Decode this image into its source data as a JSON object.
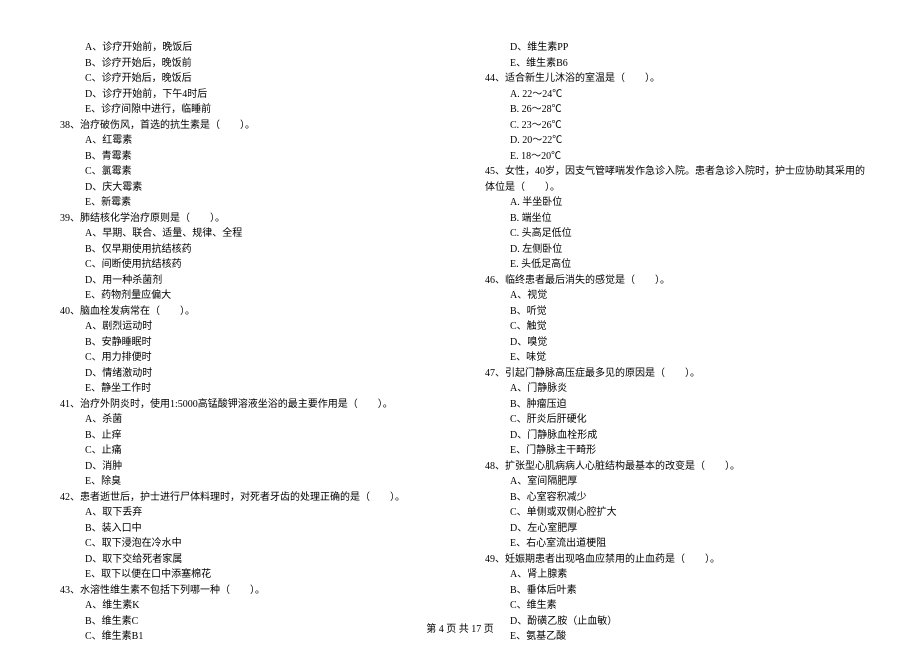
{
  "left": {
    "q37_opts": [
      "A、诊疗开始前，晚饭后",
      "B、诊疗开始后，晚饭前",
      "C、诊疗开始后，晚饭后",
      "D、诊疗开始前，下午4时后",
      "E、诊疗间隙中进行，临睡前"
    ],
    "q38": "38、治疗破伤风，首选的抗生素是（　　）。",
    "q38_opts": [
      "A、红霉素",
      "B、青霉素",
      "C、氯霉素",
      "D、庆大霉素",
      "E、新霉素"
    ],
    "q39": "39、肺结核化学治疗原则是（　　）。",
    "q39_opts": [
      "A、早期、联合、适量、规律、全程",
      "B、仅早期使用抗结核药",
      "C、间断使用抗结核药",
      "D、用一种杀菌剂",
      "E、药物剂量应偏大"
    ],
    "q40": "40、脑血栓发病常在（　　）。",
    "q40_opts": [
      "A、剧烈运动时",
      "B、安静睡眠时",
      "C、用力排便时",
      "D、情绪激动时",
      "E、静坐工作时"
    ],
    "q41": "41、治疗外阴炎时，使用1:5000高锰酸钾溶液坐浴的最主要作用是（　　）。",
    "q41_opts": [
      "A、杀菌",
      "B、止痒",
      "C、止痛",
      "D、消肿",
      "E、除臭"
    ],
    "q42": "42、患者逝世后，护士进行尸体料理时，对死者牙齿的处理正确的是（　　）。",
    "q42_opts": [
      "A、取下丢弃",
      "B、装入口中",
      "C、取下浸泡在冷水中",
      "D、取下交给死者家属",
      "E、取下以便在口中添塞棉花"
    ],
    "q43": "43、水溶性维生素不包括下列哪一种（　　）。",
    "q43_opts": [
      "A、维生素K",
      "B、维生素C",
      "C、维生素B1"
    ]
  },
  "right": {
    "q43_opts_cont": [
      "D、维生素PP",
      "E、维生素B6"
    ],
    "q44": "44、适合新生儿沐浴的室温是（　　）。",
    "q44_opts": [
      "A. 22～24℃",
      "B. 26～28℃",
      "C. 23～26℃",
      "D. 20～22℃",
      "E. 18～20℃"
    ],
    "q45": "45、女性，40岁，因支气管哮喘发作急诊入院。患者急诊入院时，护士应协助其采用的体位是（　　）。",
    "q45_opts": [
      "A. 半坐卧位",
      "B. 端坐位",
      "C. 头高足低位",
      "D. 左侧卧位",
      "E. 头低足高位"
    ],
    "q46": "46、临终患者最后消失的感觉是（　　）。",
    "q46_opts": [
      "A、视觉",
      "B、听觉",
      "C、触觉",
      "D、嗅觉",
      "E、味觉"
    ],
    "q47": "47、引起门静脉高压症最多见的原因是（　　）。",
    "q47_opts": [
      "A、门静脉炎",
      "B、肿瘤压迫",
      "C、肝炎后肝硬化",
      "D、门静脉血栓形成",
      "E、门静脉主干畸形"
    ],
    "q48": "48、扩张型心肌病病人心脏结构最基本的改变是（　　）。",
    "q48_opts": [
      "A、室间隔肥厚",
      "B、心室容积减少",
      "C、单侧或双侧心腔扩大",
      "D、左心室肥厚",
      "E、右心室流出道梗阻"
    ],
    "q49": "49、妊娠期患者出现咯血应禁用的止血药是（　　）。",
    "q49_opts": [
      "A、肾上腺素",
      "B、垂体后叶素",
      "C、维生素",
      "D、酚磺乙胺（止血敏）",
      "E、氨基乙酸"
    ]
  },
  "footer": "第 4 页 共 17 页"
}
